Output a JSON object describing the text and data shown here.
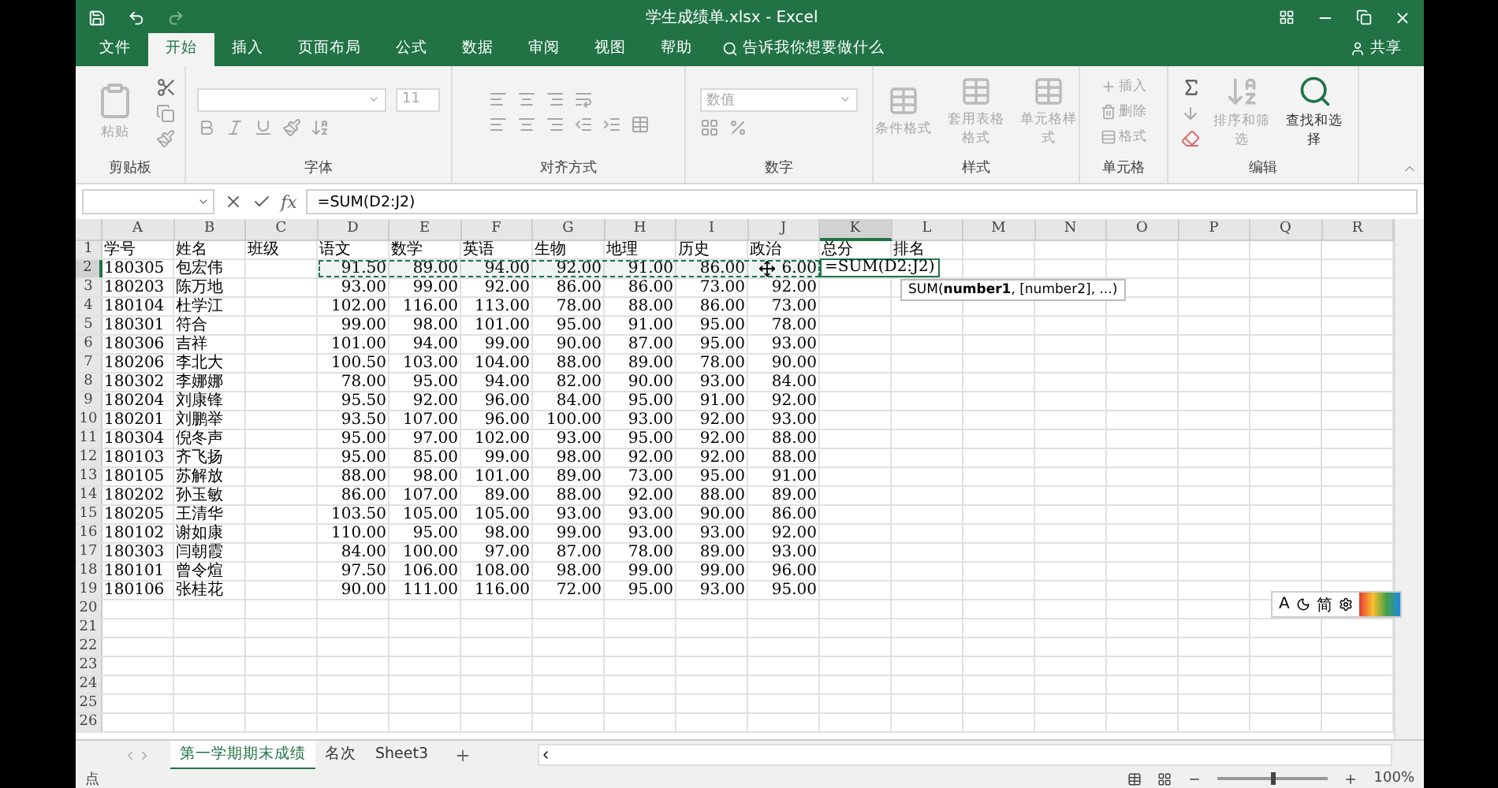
{
  "window": {
    "title": "学生成绩单.xlsx - Excel"
  },
  "tabs": [
    {
      "label": "文件",
      "selected": false
    },
    {
      "label": "开始",
      "selected": true
    },
    {
      "label": "插入",
      "selected": false
    },
    {
      "label": "页面布局",
      "selected": false
    },
    {
      "label": "公式",
      "selected": false
    },
    {
      "label": "数据",
      "selected": false
    },
    {
      "label": "审阅",
      "selected": false
    },
    {
      "label": "视图",
      "selected": false
    },
    {
      "label": "帮助",
      "selected": false
    }
  ],
  "tell_me": "告诉我你想要做什么",
  "share": "共享",
  "ribbon": {
    "font_size": "11",
    "number_format": "数值",
    "groups": [
      {
        "kind": "clipboard",
        "label": "剪贴板",
        "buttons": [
          {
            "label": "粘贴",
            "disabled": true
          }
        ]
      },
      {
        "kind": "font",
        "label": "字体"
      },
      {
        "kind": "align",
        "label": "对齐方式"
      },
      {
        "kind": "number",
        "label": "数字"
      },
      {
        "kind": "styles",
        "label": "样式",
        "buttons": [
          {
            "label": "条件格式",
            "disabled": true
          },
          {
            "label": "套用表格格式",
            "disabled": true
          },
          {
            "label": "单元格样式",
            "disabled": true
          }
        ]
      },
      {
        "kind": "cells",
        "label": "单元格",
        "buttons": [
          {
            "label": "插入",
            "disabled": true
          },
          {
            "label": "删除",
            "disabled": true
          },
          {
            "label": "格式",
            "disabled": true
          }
        ]
      },
      {
        "kind": "edit",
        "label": "编辑",
        "buttons": [
          {
            "label": "排序和筛选",
            "disabled": true
          },
          {
            "label": "查找和选择",
            "disabled": false
          }
        ]
      }
    ]
  },
  "formula_bar": {
    "fx_label": "fx",
    "formula": "=SUM(D2:J2)"
  },
  "columns": [
    {
      "label": "A",
      "selected": false
    },
    {
      "label": "B",
      "selected": false
    },
    {
      "label": "C",
      "selected": false
    },
    {
      "label": "D",
      "selected": false
    },
    {
      "label": "E",
      "selected": false
    },
    {
      "label": "F",
      "selected": false
    },
    {
      "label": "G",
      "selected": false
    },
    {
      "label": "H",
      "selected": false
    },
    {
      "label": "I",
      "selected": false
    },
    {
      "label": "J",
      "selected": false
    },
    {
      "label": "K",
      "selected": true
    },
    {
      "label": "L",
      "selected": false
    },
    {
      "label": "M",
      "selected": false
    },
    {
      "label": "N",
      "selected": false
    },
    {
      "label": "O",
      "selected": false
    },
    {
      "label": "P",
      "selected": false
    },
    {
      "label": "Q",
      "selected": false
    },
    {
      "label": "R",
      "selected": false
    }
  ],
  "header_row": {
    "number": "1",
    "cells": [
      "学号",
      "姓名",
      "班级",
      "语文",
      "数学",
      "英语",
      "生物",
      "地理",
      "历史",
      "政治",
      "总分",
      "排名"
    ]
  },
  "rows": [
    {
      "number": "2",
      "selected": true,
      "in_formula": true,
      "id": "180305",
      "name": "包宏伟",
      "scores": [
        "91.50",
        "89.00",
        "94.00",
        "92.00",
        "91.00",
        "86.00",
        "6.00"
      ],
      "total_edit": "=SUM(D2:J2)",
      "tooltip": "SUM(**number1**, [number2], ...)"
    },
    {
      "number": "3",
      "selected": false,
      "in_formula": false,
      "id": "180203",
      "name": "陈万地",
      "scores": [
        "93.00",
        "99.00",
        "92.00",
        "86.00",
        "86.00",
        "73.00",
        "92.00"
      ]
    },
    {
      "number": "4",
      "selected": false,
      "in_formula": false,
      "id": "180104",
      "name": "杜学江",
      "scores": [
        "102.00",
        "116.00",
        "113.00",
        "78.00",
        "88.00",
        "86.00",
        "73.00"
      ]
    },
    {
      "number": "5",
      "selected": false,
      "in_formula": false,
      "id": "180301",
      "name": "符合",
      "scores": [
        "99.00",
        "98.00",
        "101.00",
        "95.00",
        "91.00",
        "95.00",
        "78.00"
      ]
    },
    {
      "number": "6",
      "selected": false,
      "in_formula": false,
      "id": "180306",
      "name": "吉祥",
      "scores": [
        "101.00",
        "94.00",
        "99.00",
        "90.00",
        "87.00",
        "95.00",
        "93.00"
      ]
    },
    {
      "number": "7",
      "selected": false,
      "in_formula": false,
      "id": "180206",
      "name": "李北大",
      "scores": [
        "100.50",
        "103.00",
        "104.00",
        "88.00",
        "89.00",
        "78.00",
        "90.00"
      ]
    },
    {
      "number": "8",
      "selected": false,
      "in_formula": false,
      "id": "180302",
      "name": "李娜娜",
      "scores": [
        "78.00",
        "95.00",
        "94.00",
        "82.00",
        "90.00",
        "93.00",
        "84.00"
      ]
    },
    {
      "number": "9",
      "selected": false,
      "in_formula": false,
      "id": "180204",
      "name": "刘康锋",
      "scores": [
        "95.50",
        "92.00",
        "96.00",
        "84.00",
        "95.00",
        "91.00",
        "92.00"
      ]
    },
    {
      "number": "10",
      "selected": false,
      "in_formula": false,
      "id": "180201",
      "name": "刘鹏举",
      "scores": [
        "93.50",
        "107.00",
        "96.00",
        "100.00",
        "93.00",
        "92.00",
        "93.00"
      ]
    },
    {
      "number": "11",
      "selected": false,
      "in_formula": false,
      "id": "180304",
      "name": "倪冬声",
      "scores": [
        "95.00",
        "97.00",
        "102.00",
        "93.00",
        "95.00",
        "92.00",
        "88.00"
      ]
    },
    {
      "number": "12",
      "selected": false,
      "in_formula": false,
      "id": "180103",
      "name": "齐飞扬",
      "scores": [
        "95.00",
        "85.00",
        "99.00",
        "98.00",
        "92.00",
        "92.00",
        "88.00"
      ]
    },
    {
      "number": "13",
      "selected": false,
      "in_formula": false,
      "id": "180105",
      "name": "苏解放",
      "scores": [
        "88.00",
        "98.00",
        "101.00",
        "89.00",
        "73.00",
        "95.00",
        "91.00"
      ]
    },
    {
      "number": "14",
      "selected": false,
      "in_formula": false,
      "id": "180202",
      "name": "孙玉敏",
      "scores": [
        "86.00",
        "107.00",
        "89.00",
        "88.00",
        "92.00",
        "88.00",
        "89.00"
      ]
    },
    {
      "number": "15",
      "selected": false,
      "in_formula": false,
      "id": "180205",
      "name": "王清华",
      "scores": [
        "103.50",
        "105.00",
        "105.00",
        "93.00",
        "93.00",
        "90.00",
        "86.00"
      ]
    },
    {
      "number": "16",
      "selected": false,
      "in_formula": false,
      "id": "180102",
      "name": "谢如康",
      "scores": [
        "110.00",
        "95.00",
        "98.00",
        "99.00",
        "93.00",
        "93.00",
        "92.00"
      ]
    },
    {
      "number": "17",
      "selected": false,
      "in_formula": false,
      "id": "180303",
      "name": "闫朝霞",
      "scores": [
        "84.00",
        "100.00",
        "97.00",
        "87.00",
        "78.00",
        "89.00",
        "93.00"
      ]
    },
    {
      "number": "18",
      "selected": false,
      "in_formula": false,
      "id": "180101",
      "name": "曾令煊",
      "scores": [
        "97.50",
        "106.00",
        "108.00",
        "98.00",
        "99.00",
        "99.00",
        "96.00"
      ]
    },
    {
      "number": "19",
      "selected": false,
      "in_formula": false,
      "id": "180106",
      "name": "张桂花",
      "scores": [
        "90.00",
        "111.00",
        "116.00",
        "72.00",
        "95.00",
        "93.00",
        "95.00"
      ]
    },
    {
      "number": "20",
      "selected": false,
      "in_formula": false
    },
    {
      "number": "21",
      "selected": false,
      "in_formula": false
    },
    {
      "number": "22",
      "selected": false,
      "in_formula": false
    },
    {
      "number": "23",
      "selected": false,
      "in_formula": false
    },
    {
      "number": "24",
      "selected": false,
      "in_formula": false
    },
    {
      "number": "25",
      "selected": false,
      "in_formula": false
    },
    {
      "number": "26",
      "selected": false,
      "in_formula": false
    }
  ],
  "ime_toolbar": {
    "mode": "A",
    "script": "简"
  },
  "sheet_tabs": [
    {
      "label": "第一学期期末成绩",
      "selected": true
    },
    {
      "label": "名次",
      "selected": false
    },
    {
      "label": "Sheet3",
      "selected": false
    }
  ],
  "status_bar": {
    "mode": "点",
    "zoom": {
      "label": "100%",
      "level": 0.5
    }
  }
}
